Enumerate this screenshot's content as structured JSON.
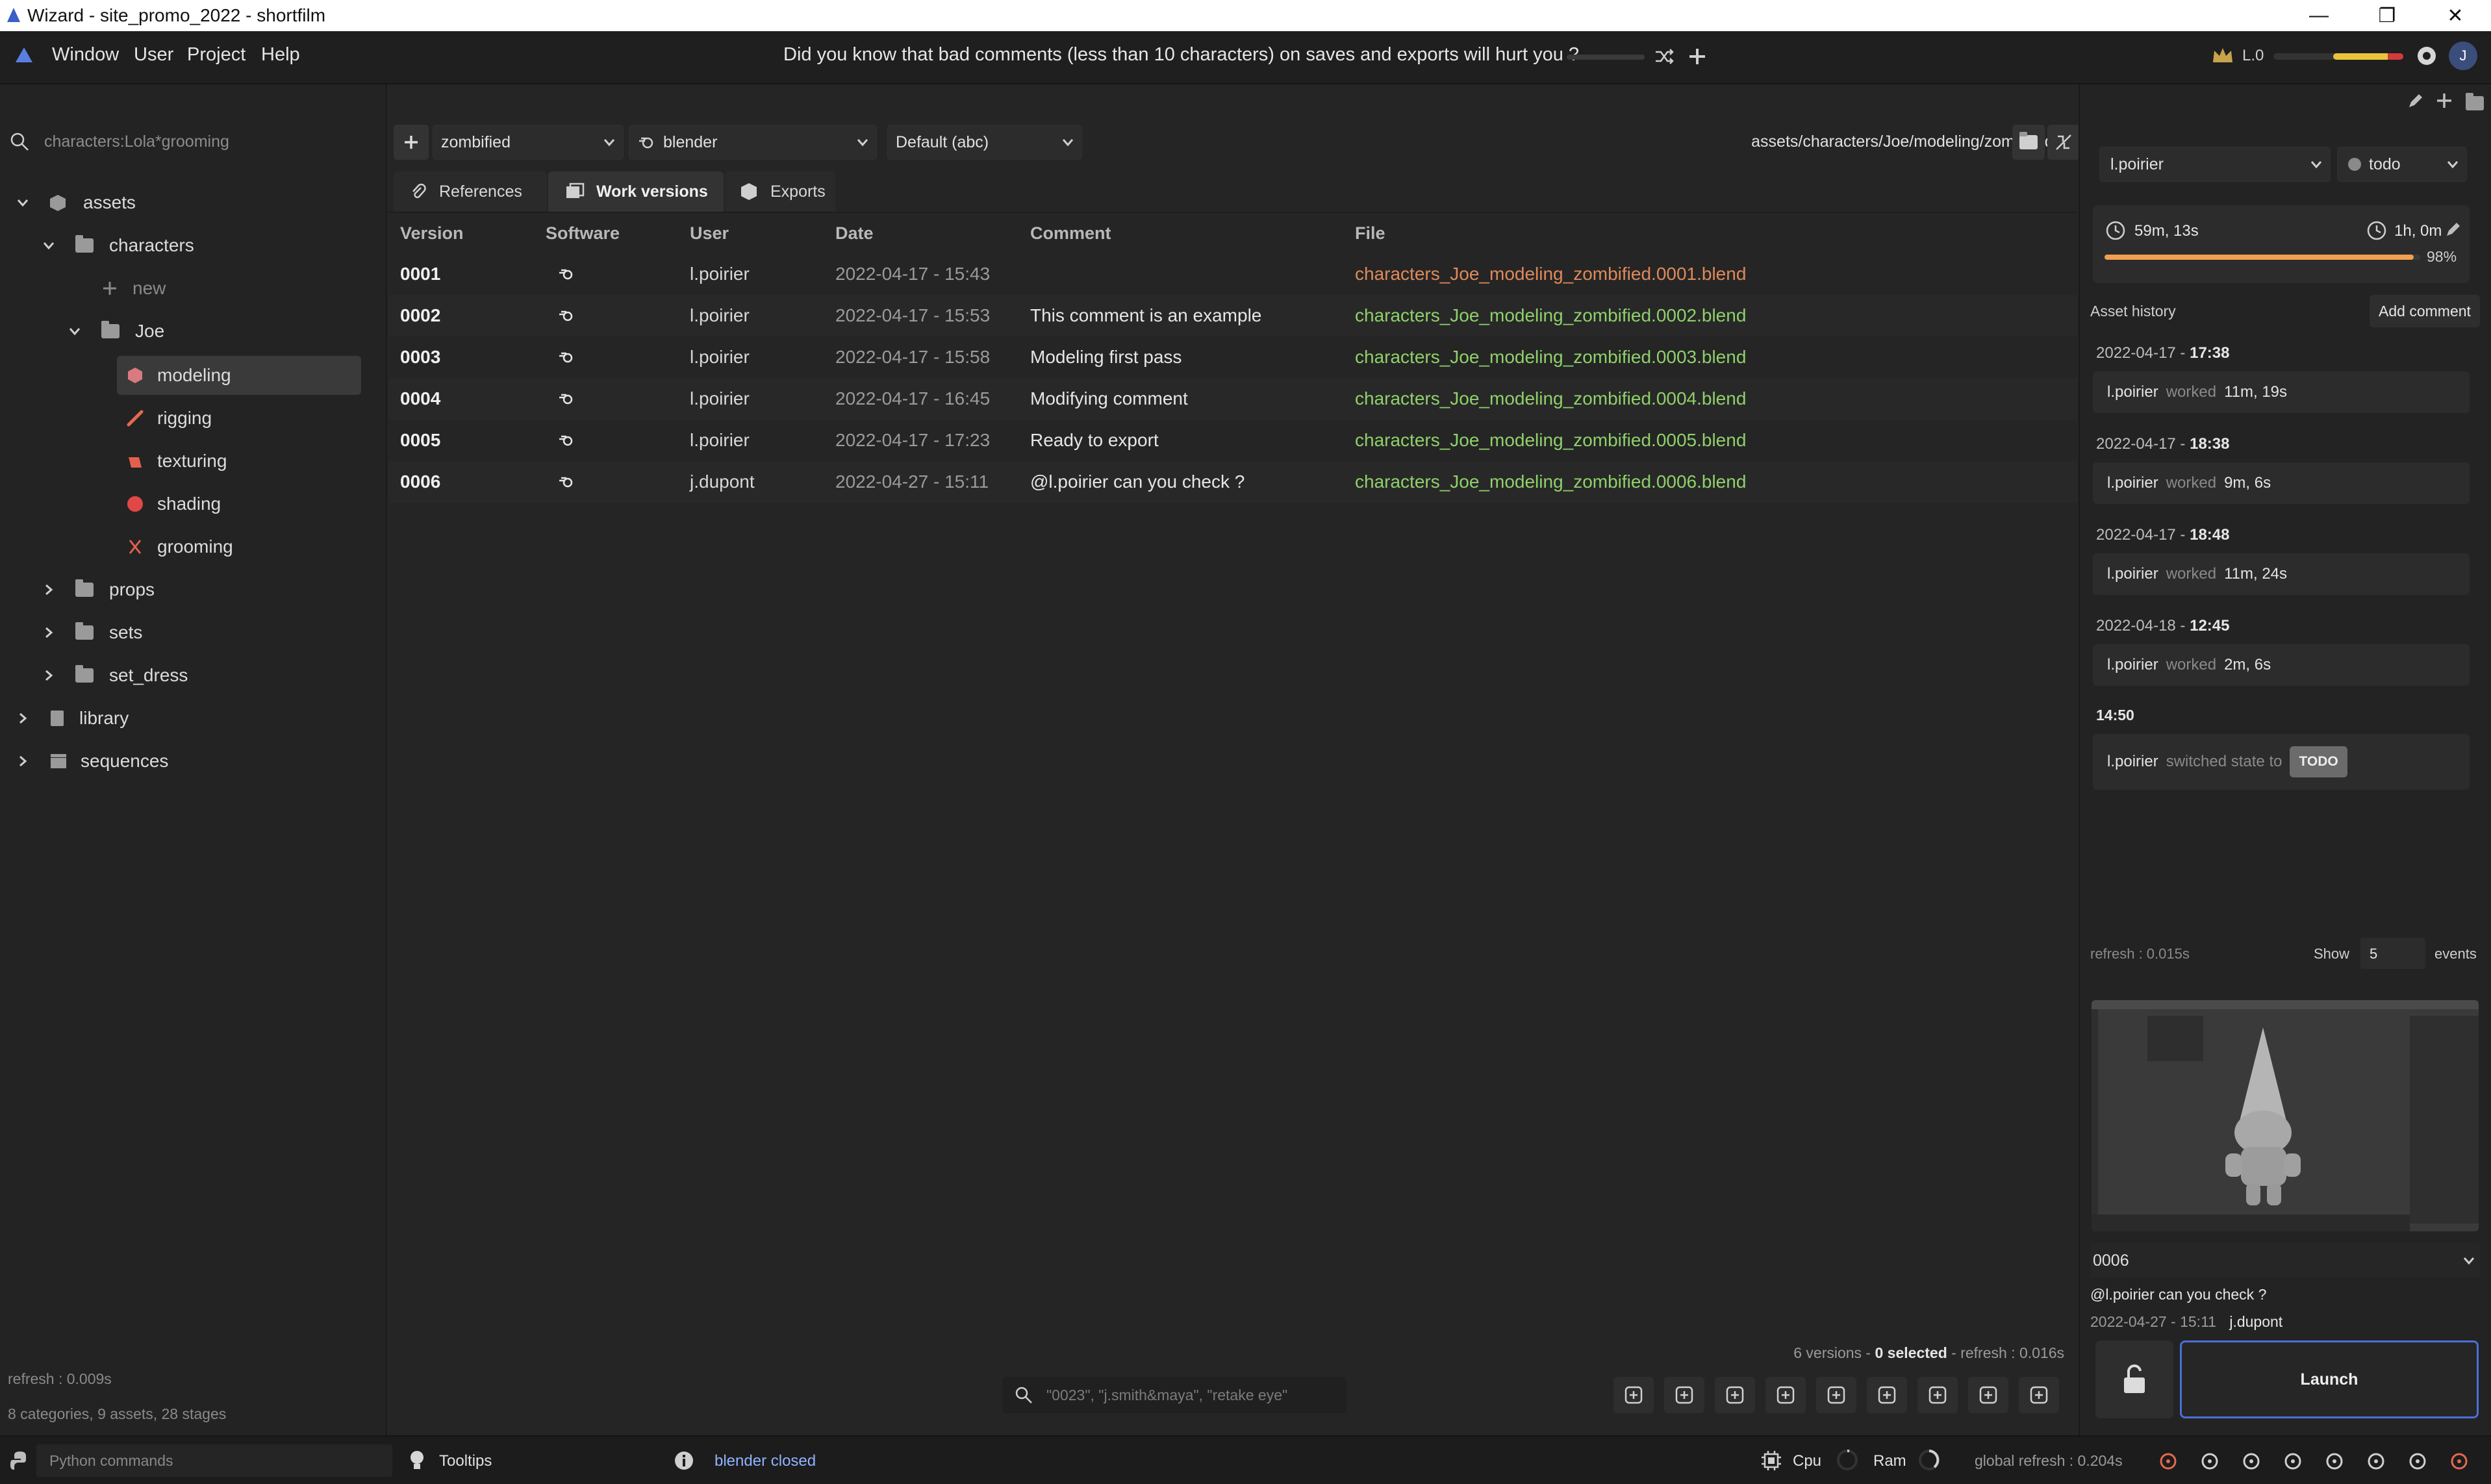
{
  "window": {
    "title": "Wizard - site_promo_2022 - shortfilm"
  },
  "menu": {
    "items": [
      "Window",
      "User",
      "Project",
      "Help"
    ]
  },
  "tip": "Did you know that bad comments (less than 10 characters) on saves and exports will hurt you ?",
  "user_level": "L.0",
  "avatar_letter": "J",
  "search": {
    "value": "characters:Lola*grooming"
  },
  "tree": {
    "assets": "assets",
    "characters": "characters",
    "new": "new",
    "joe": "Joe",
    "stages": [
      "modeling",
      "rigging",
      "texturing",
      "shading",
      "grooming"
    ],
    "props": "props",
    "sets": "sets",
    "set_dress": "set_dress",
    "library": "library",
    "sequences": "sequences"
  },
  "left_footer": {
    "refresh": "refresh : 0.009s",
    "summary": "8 categories, 9 assets, 28 stages"
  },
  "toolbar": {
    "variant": "zombified",
    "software": "blender",
    "export_set": "Default (abc)",
    "path": "assets/characters/Joe/modeling/zombified/blender"
  },
  "tabs": [
    "References",
    "Work versions",
    "Exports"
  ],
  "table": {
    "headers": [
      "Version",
      "Software",
      "User",
      "Date",
      "Comment",
      "File"
    ],
    "rows": [
      {
        "version": "0001",
        "user": "l.poirier",
        "date": "2022-04-17 - 15:43",
        "comment": "",
        "file": "characters_Joe_modeling_zombified.0001.blend"
      },
      {
        "version": "0002",
        "user": "l.poirier",
        "date": "2022-04-17 - 15:53",
        "comment": "This comment is an example",
        "file": "characters_Joe_modeling_zombified.0002.blend"
      },
      {
        "version": "0003",
        "user": "l.poirier",
        "date": "2022-04-17 - 15:58",
        "comment": "Modeling first pass",
        "file": "characters_Joe_modeling_zombified.0003.blend"
      },
      {
        "version": "0004",
        "user": "l.poirier",
        "date": "2022-04-17 - 16:45",
        "comment": "Modifying comment",
        "file": "characters_Joe_modeling_zombified.0004.blend"
      },
      {
        "version": "0005",
        "user": "l.poirier",
        "date": "2022-04-17 - 17:23",
        "comment": "Ready to export",
        "file": "characters_Joe_modeling_zombified.0005.blend"
      },
      {
        "version": "0006",
        "user": "j.dupont",
        "date": "2022-04-27 - 15:11",
        "comment": "@l.poirier can you check ?",
        "file": "characters_Joe_modeling_zombified.0006.blend"
      }
    ]
  },
  "center_footer": {
    "versions": "6 versions",
    "sep": " - ",
    "selected": "0 selected",
    "refresh": " - refresh : 0.016s",
    "search_placeholder": "\"0023\", \"j.smith&maya\", \"retake eye\""
  },
  "right": {
    "assignee": "l.poirier",
    "state": "todo",
    "time_spent": "59m, 13s",
    "estimate": "1h, 0m",
    "progress_pct": 98,
    "progress_label": "98%",
    "history_title": "Asset history",
    "add_comment": "Add comment",
    "history": [
      {
        "date": "2022-04-17 - ",
        "time": "17:38",
        "user": "l.poirier",
        "action": "worked",
        "value": "11m, 19s"
      },
      {
        "date": "2022-04-17 - ",
        "time": "18:38",
        "user": "l.poirier",
        "action": "worked",
        "value": "9m, 6s"
      },
      {
        "date": "2022-04-17 - ",
        "time": "18:48",
        "user": "l.poirier",
        "action": "worked",
        "value": "11m, 24s"
      },
      {
        "date": "2022-04-18 - ",
        "time": "12:45",
        "user": "l.poirier",
        "action": "worked",
        "value": "2m, 6s"
      }
    ],
    "last_time": "14:50",
    "state_change": {
      "user": "l.poirier",
      "action": "switched state to",
      "state": "TODO"
    },
    "refresh": "refresh : 0.015s",
    "show_label": "Show",
    "show_value": "5",
    "events_label": "events",
    "selected_version": "0006",
    "version_comment": "@l.poirier can you check ?",
    "version_date": "2022-04-27 - 15:11",
    "version_user": "j.dupont",
    "launch": "Launch"
  },
  "status": {
    "python_placeholder": "Python commands",
    "tooltips": "Tooltips",
    "message": "blender closed",
    "cpu": "Cpu",
    "ram": "Ram",
    "global_refresh": "global refresh : 0.204s"
  },
  "colors": {
    "file_latest_old": "#e0895a",
    "file_green": "#8fd16a",
    "launch_border": "#4a6fd8",
    "progress": "#f0a050"
  }
}
